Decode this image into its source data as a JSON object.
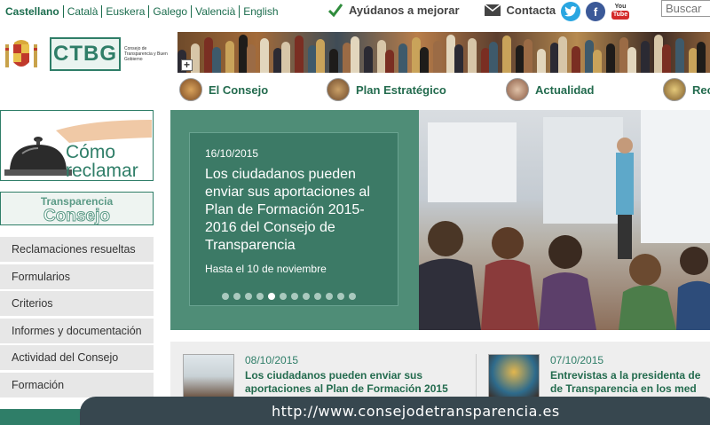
{
  "languages": [
    "Castellano",
    "Català",
    "Euskera",
    "Galego",
    "Valencià",
    "English"
  ],
  "top_links": {
    "help_label": "Ayúdanos a mejorar",
    "contact_label": "Contacta"
  },
  "social": {
    "youtube_top": "You",
    "youtube_bottom": "Tube",
    "facebook_letter": "f"
  },
  "search": {
    "placeholder": "Buscar"
  },
  "logo": {
    "acronym": "CTBG",
    "name": "Consejo de Transparencia y Buen Gobierno"
  },
  "main_nav": [
    "El Consejo",
    "Plan Estratégico",
    "Actualidad",
    "Rec"
  ],
  "left": {
    "como_reclamar": [
      "Cómo",
      "reclamar"
    ],
    "transparencia_label": "Transparencia",
    "consejo_label": "Consejo",
    "menu": [
      "Reclamaciones resueltas",
      "Formularios",
      "Criterios",
      "Informes y documentación",
      "Actividad del Consejo",
      "Formación"
    ]
  },
  "slider": {
    "date": "16/10/2015",
    "title": "Los ciudadanos pueden enviar sus aportaciones al Plan de Formación 2015-2016 del Consejo de Transparencia",
    "subtitle": "Hasta el 10 de noviembre",
    "dot_count": 12,
    "active_dot": 5
  },
  "news": [
    {
      "date": "08/10/2015",
      "title_line1": "Los ciudadanos pueden enviar sus",
      "title_line2": "aportaciones al Plan de Formación 2015"
    },
    {
      "date": "07/10/2015",
      "title_line1": "Entrevistas a la presidenta de",
      "title_line2": "de Transparencia en los med"
    }
  ],
  "url_overlay": "http://www.consejodetransparencia.es",
  "colors": {
    "brand_green": "#2f7e68",
    "link_green": "#236b4e",
    "slide_bg": "#4f8d77",
    "overlay": "#37474f"
  }
}
